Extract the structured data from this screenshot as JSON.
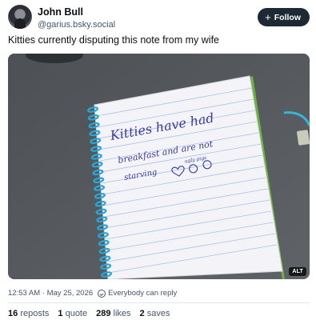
{
  "author": {
    "display_name": "John Bull",
    "handle": "@garius.bsky.social",
    "avatar_icon": "person-avatar"
  },
  "follow_button": {
    "label": "Follow",
    "icon": "plus-icon"
  },
  "post": {
    "text": "Kitties currently disputing this note from my wife",
    "image": {
      "alt_badge": "ALT",
      "note_lines": [
        "Kitties have had",
        "breakfast and are not",
        "starving",
        "ugly pigs"
      ]
    }
  },
  "meta": {
    "timestamp": "12:53 AM · May 25, 2026",
    "reply_setting": "Everybody can reply",
    "reply_icon": "reply-setting-icon"
  },
  "stats": {
    "reposts_count": "16",
    "reposts_label": "reposts",
    "quotes_count": "1",
    "quotes_label": "quote",
    "likes_count": "289",
    "likes_label": "likes",
    "saves_count": "2",
    "saves_label": "saves"
  },
  "colors": {
    "text_primary": "#0b0f14",
    "text_secondary": "#42576c",
    "button_bg": "#1e2936",
    "divider": "#e3e8ee",
    "note_ink": "#3a3aa0",
    "spiral": "#2aa7d6",
    "notebook_cover": "#6db33f"
  }
}
